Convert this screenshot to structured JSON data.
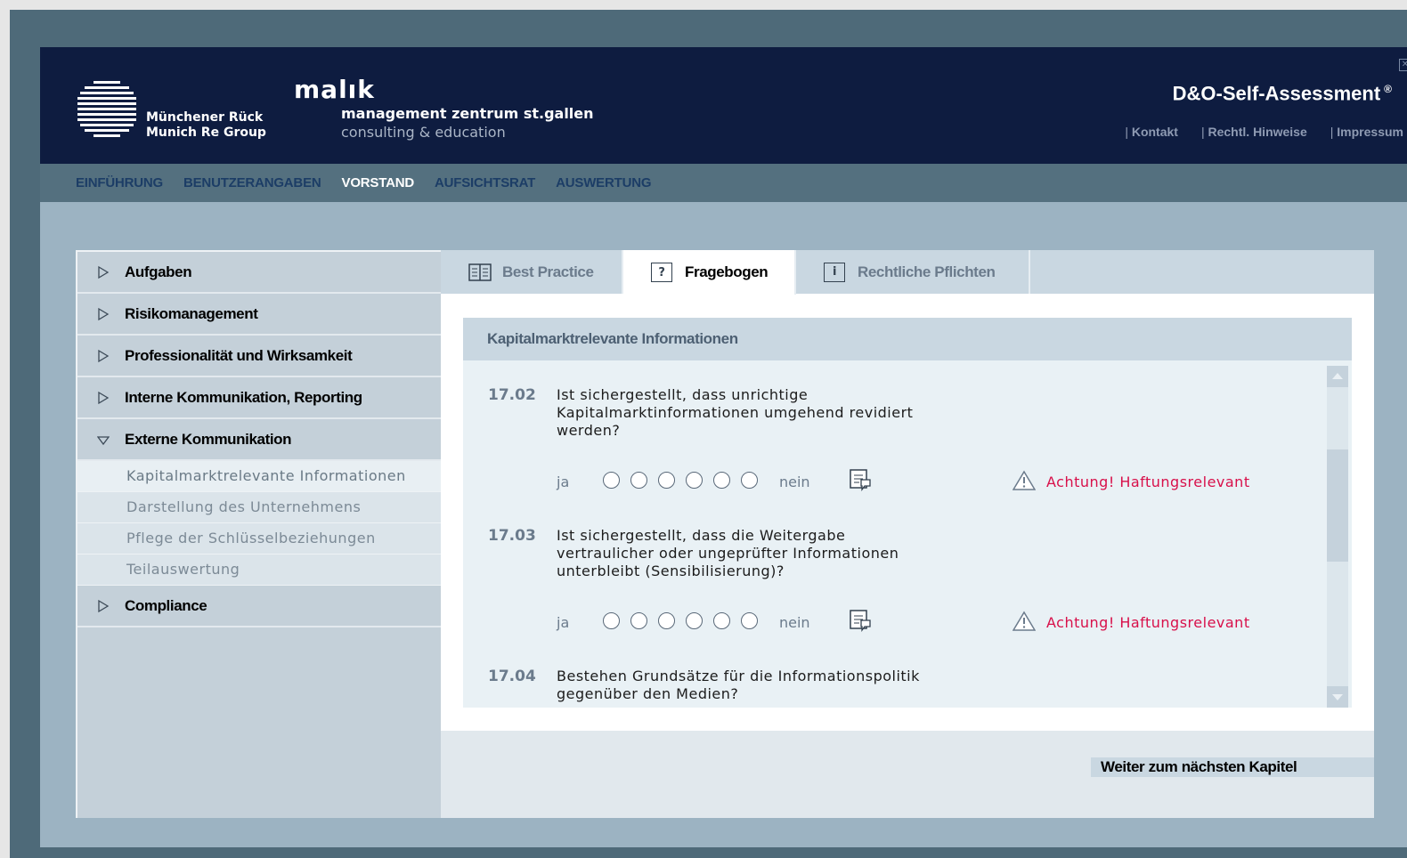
{
  "header": {
    "munich_line1": "Münchener Rück",
    "munich_line2": "Munich Re Group",
    "malik": "malık",
    "mzsg_line1": "management zentrum st.gallen",
    "mzsg_line2": "consulting & education",
    "title": "D&O-Self-Assessment",
    "title_mark": "®",
    "links": [
      "Kontakt",
      "Rechtl. Hinweise",
      "Impressum"
    ]
  },
  "nav": {
    "items": [
      "EINFÜHRUNG",
      "BENUTZERANGABEN",
      "VORSTAND",
      "AUFSICHTSRAT",
      "AUSWERTUNG"
    ],
    "active": "VORSTAND"
  },
  "sidebar": {
    "categories": [
      "Aufgaben",
      "Risikomanagement",
      "Professionalität und Wirksamkeit",
      "Interne Kommunikation, Reporting",
      "Externe Kommunikation",
      "Compliance"
    ],
    "subitems": [
      "Kapitalmarktrelevante Informationen",
      "Darstellung des Unternehmens",
      "Pflege der Schlüsselbeziehungen",
      "Teilauswertung"
    ],
    "active_subitem": "Kapitalmarktrelevante Informationen"
  },
  "tabs": {
    "best_practice": "Best Practice",
    "fragebogen": "Fragebogen",
    "rechtliche": "Rechtliche Pflichten",
    "fragebogen_icon_glyph": "?",
    "rechtliche_icon_glyph": "i"
  },
  "section": {
    "title": "Kapitalmarktrelevante Informationen"
  },
  "scale": {
    "left": "ja",
    "right": "nein"
  },
  "questions": [
    {
      "num": "17.02",
      "text": "Ist sichergestellt, dass unrichtige Kapitalmarktinformationen umgehend revidiert werden?",
      "warning": "Achtung! Haftungsrelevant"
    },
    {
      "num": "17.03",
      "text": "Ist sichergestellt, dass die Weitergabe vertraulicher oder ungeprüfter Informationen unterbleibt (Sensibilisierung)?",
      "warning": "Achtung! Haftungsrelevant"
    },
    {
      "num": "17.04",
      "text": "Bestehen Grundsätze für die Informationspolitik gegenüber den Medien?"
    }
  ],
  "footer": {
    "next_label": "Weiter zum nächsten Kapitel"
  },
  "colors": {
    "header_bg": "#0e1c40",
    "nav_bg": "#54707f",
    "warning": "#d8104a",
    "panel_bg": "#e9f1f5"
  }
}
